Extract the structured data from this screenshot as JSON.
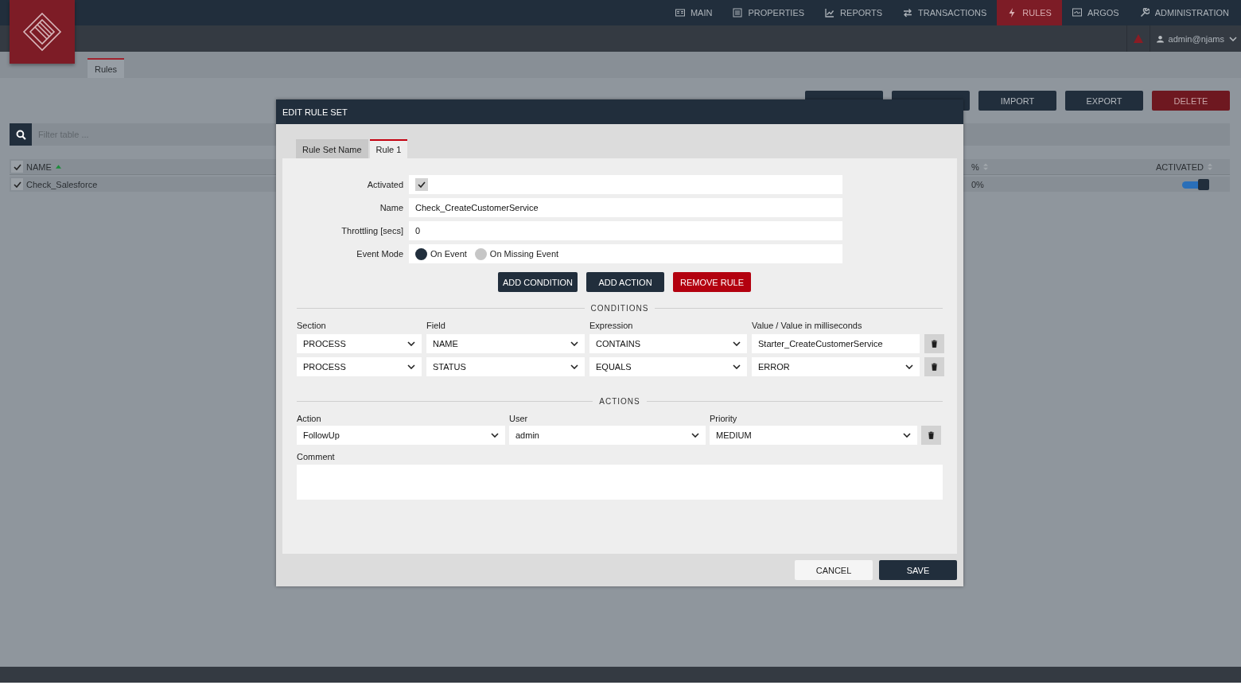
{
  "nav": [
    {
      "label": "MAIN",
      "selected": false
    },
    {
      "label": "PROPERTIES",
      "selected": false
    },
    {
      "label": "REPORTS",
      "selected": false
    },
    {
      "label": "TRANSACTIONS",
      "selected": false
    },
    {
      "label": "RULES",
      "selected": true
    },
    {
      "label": "ARGOS",
      "selected": false
    },
    {
      "label": "ADMINISTRATION",
      "selected": false
    }
  ],
  "user": "admin@njams",
  "page_tabs": [
    {
      "label": "Rules",
      "selected": true
    }
  ],
  "toolbar": [
    {
      "label": "IMPORT",
      "kind": "normal"
    },
    {
      "label": "EXPORT",
      "kind": "normal"
    },
    {
      "label": "DELETE",
      "kind": "danger"
    }
  ],
  "filter": {
    "placeholder": "Filter table ..."
  },
  "table": {
    "all_checked": true,
    "columns": [
      {
        "label": "NAME",
        "sorted": true
      },
      {
        "label": "%",
        "sorted": false
      },
      {
        "label": "ACTIVATED",
        "sorted": false
      }
    ],
    "rows": [
      {
        "checked": true,
        "name": "Check_Salesforce",
        "percent": "0%",
        "activated": true
      }
    ]
  },
  "dialog": {
    "title": "EDIT RULE SET",
    "tabs": [
      {
        "label": "Rule Set Name",
        "selected": false
      },
      {
        "label": "Rule 1",
        "selected": true
      }
    ],
    "activated": {
      "label": "Activated",
      "checked": true
    },
    "name": {
      "label": "Name",
      "value": "Check_CreateCustomerService"
    },
    "throttling": {
      "label": "Throttling [secs]",
      "value": "0"
    },
    "event_mode": {
      "label": "Event Mode",
      "options": [
        {
          "label": "On Event",
          "selected": true
        },
        {
          "label": "On Missing Event",
          "selected": false
        }
      ]
    },
    "buttons": [
      {
        "label": "ADD CONDITION",
        "kind": "dark"
      },
      {
        "label": "ADD ACTION",
        "kind": "dark"
      },
      {
        "label": "REMOVE RULE",
        "kind": "danger"
      }
    ],
    "conditions": {
      "title": "CONDITIONS",
      "headers": [
        "Section",
        "Field",
        "Expression",
        "Value / Value in milliseconds"
      ],
      "rows": [
        {
          "section": "PROCESS",
          "field": "NAME",
          "expression": "CONTAINS",
          "value": {
            "kind": "input",
            "text": "Starter_CreateCustomerService"
          }
        },
        {
          "section": "PROCESS",
          "field": "STATUS",
          "expression": "EQUALS",
          "value": {
            "kind": "select",
            "text": "ERROR"
          }
        }
      ]
    },
    "actions": {
      "title": "ACTIONS",
      "headers": [
        "Action",
        "User",
        "Priority"
      ],
      "rows": [
        {
          "action": "FollowUp",
          "user": "admin",
          "priority": "MEDIUM"
        }
      ],
      "comment_label": "Comment"
    },
    "footer": [
      {
        "label": "CANCEL",
        "kind": "light"
      },
      {
        "label": "SAVE",
        "kind": "dark"
      }
    ]
  }
}
